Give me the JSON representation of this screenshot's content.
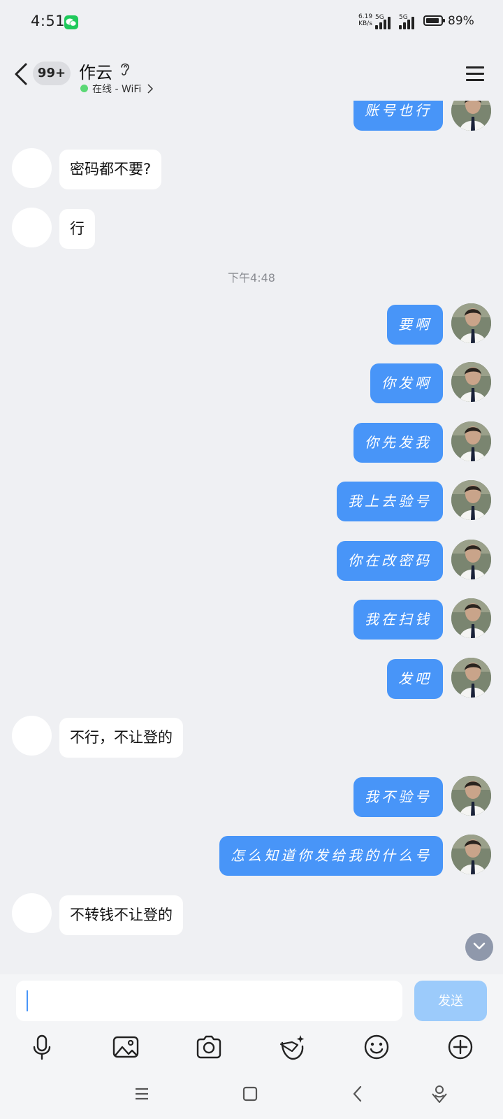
{
  "status_bar": {
    "time": "4:51",
    "network_speed_value": "6.19",
    "network_speed_unit": "KB/s",
    "signal_1_label": "5G",
    "signal_2_label": "5G",
    "battery_percent": "89%",
    "battery_level": 0.89
  },
  "header": {
    "unread_badge": "99+",
    "contact_name": "作云",
    "online_status": "在线 - WiFi"
  },
  "messages": [
    {
      "side": "out",
      "text": "账号也行"
    },
    {
      "side": "in",
      "text": "密码都不要?"
    },
    {
      "side": "in",
      "text": "行"
    },
    {
      "side": "time",
      "text": "下午4:48"
    },
    {
      "side": "out",
      "text": "要啊"
    },
    {
      "side": "out",
      "text": "你发啊"
    },
    {
      "side": "out",
      "text": "你先发我"
    },
    {
      "side": "out",
      "text": "我上去验号"
    },
    {
      "side": "out",
      "text": "你在改密码"
    },
    {
      "side": "out",
      "text": "我在扫钱"
    },
    {
      "side": "out",
      "text": "发吧"
    },
    {
      "side": "in",
      "text": "不行，不让登的"
    },
    {
      "side": "out",
      "text": "我不验号"
    },
    {
      "side": "out",
      "text": "怎么知道你发给我的什么号"
    },
    {
      "side": "in",
      "text": "不转钱不让登的"
    }
  ],
  "composer": {
    "input_value": "",
    "send_label": "发送"
  },
  "toolbar_icons": [
    "microphone-icon",
    "image-icon",
    "camera-icon",
    "face-sticker-icon",
    "emoji-icon",
    "plus-icon"
  ],
  "nav_icons": [
    "menu-icon",
    "home-icon",
    "back-icon",
    "assistant-icon"
  ],
  "colors": {
    "accent": "#4895f8",
    "background": "#eff0f3",
    "online": "#5bd875"
  }
}
